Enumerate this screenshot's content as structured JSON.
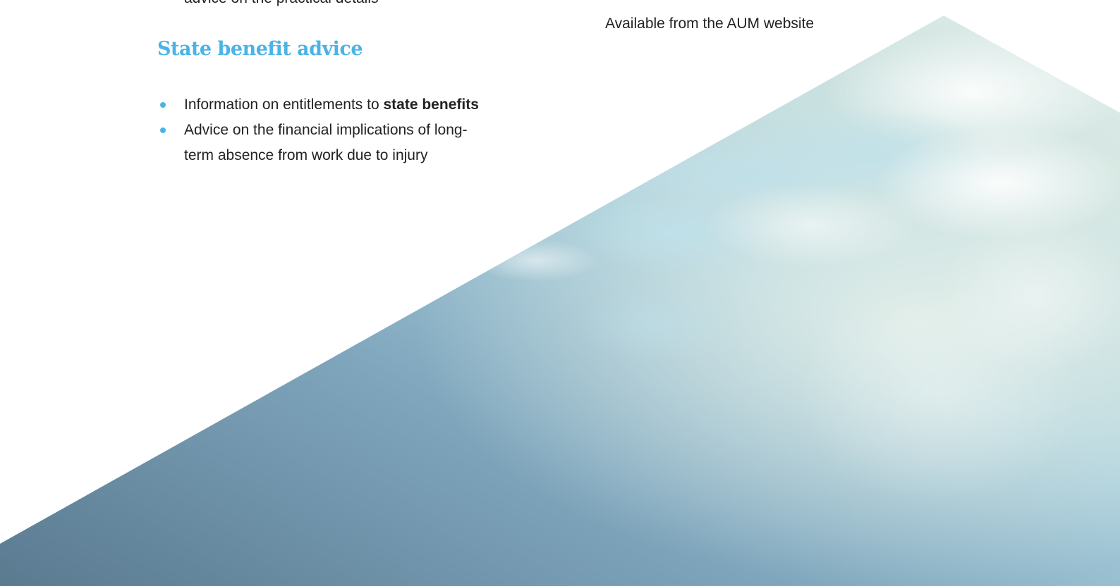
{
  "cut_off_line": "advice on the practical details",
  "available_note": "Available from the AUM website",
  "section": {
    "heading": "State benefit advice",
    "bullets": [
      {
        "text_before": "Information on entitlements to ",
        "text_bold": "state benefits"
      },
      {
        "line1": "Advice on the financial implications of long-",
        "line2": "term absence from work due to  injury"
      }
    ]
  },
  "colors": {
    "accent": "#4bb3e6",
    "body_text": "#222222",
    "sky_dark": "#567a92",
    "sky_light": "#cfe3df"
  },
  "icons": {
    "bullet": "bullet-dot-icon"
  }
}
